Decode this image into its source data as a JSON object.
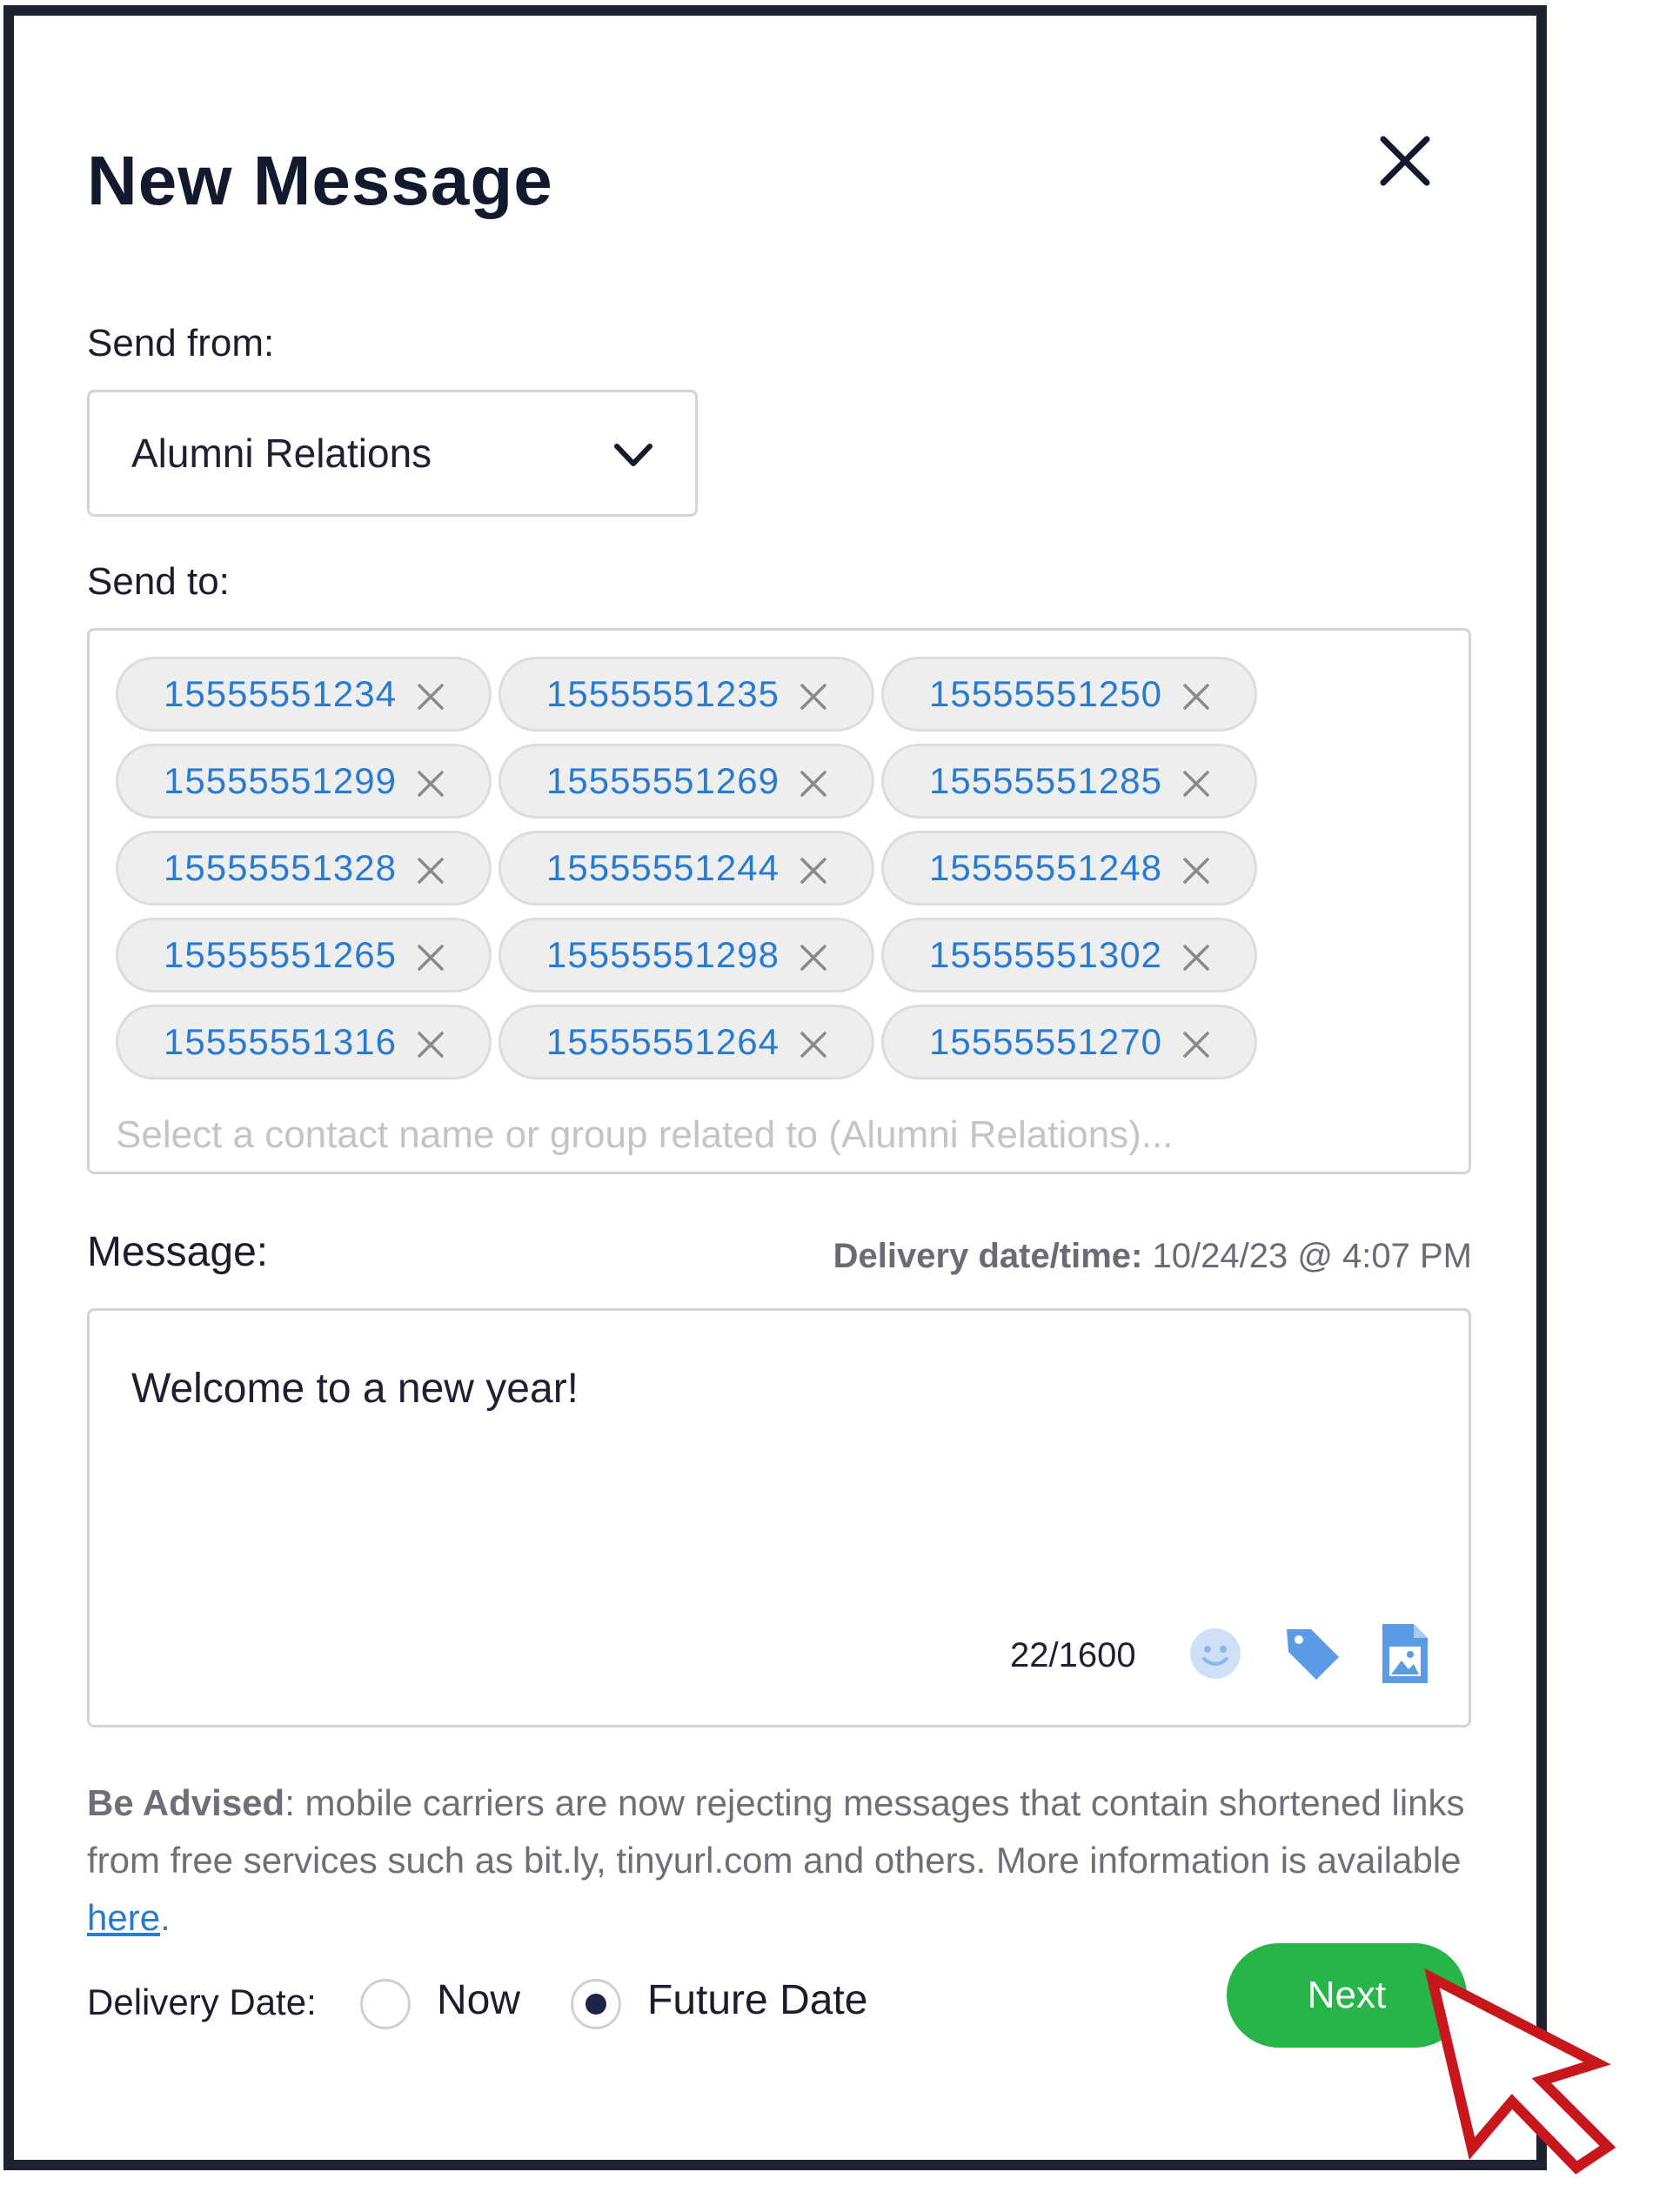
{
  "dialog": {
    "title": "New Message"
  },
  "send_from": {
    "label": "Send from:",
    "selected": "Alumni Relations"
  },
  "send_to": {
    "label": "Send to:",
    "recipients": [
      "15555551234",
      "15555551235",
      "15555551250",
      "15555551299",
      "15555551269",
      "15555551285",
      "15555551328",
      "15555551244",
      "15555551248",
      "15555551265",
      "15555551298",
      "15555551302",
      "15555551316",
      "15555551264",
      "15555551270"
    ],
    "placeholder": "Select a contact name or group related to (Alumni Relations)..."
  },
  "message": {
    "label": "Message:",
    "delivery_label": "Delivery date/time:",
    "delivery_value": "10/24/23 @ 4:07 PM",
    "text": "Welcome to a new year!",
    "counter": "22/1600",
    "icons": [
      "emoji-icon",
      "tag-icon",
      "image-file-icon"
    ]
  },
  "advisory": {
    "strong": "Be Advised",
    "text": ": mobile carriers are now rejecting messages that contain shortened links from free services such as bit.ly, tinyurl.com and others. More information is available ",
    "link": "here",
    "end": "."
  },
  "delivery_date": {
    "label": "Delivery Date:",
    "options": [
      "Now",
      "Future Date"
    ],
    "selected": "Future Date"
  },
  "actions": {
    "next_label": "Next"
  },
  "colors": {
    "accent_blue": "#2a7bd0",
    "next_green": "#27b54a",
    "cursor_red": "#c8161d",
    "icon_blue": "#5b9be6"
  }
}
